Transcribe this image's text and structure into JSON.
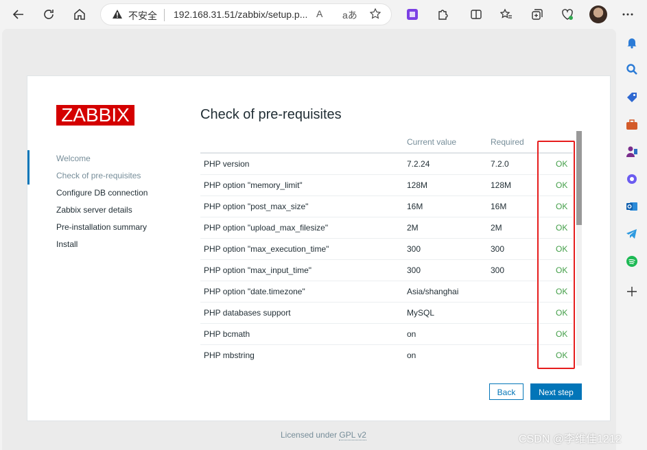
{
  "browser": {
    "insecure_label": "不安全",
    "url": "192.168.31.51/zabbix/setup.p...",
    "read_aloud_glyph": "A",
    "translate_glyph": "aあ"
  },
  "logo": "ZABBIX",
  "steps": [
    {
      "label": "Welcome"
    },
    {
      "label": "Check of pre-requisites"
    },
    {
      "label": "Configure DB connection"
    },
    {
      "label": "Zabbix server details"
    },
    {
      "label": "Pre-installation summary"
    },
    {
      "label": "Install"
    }
  ],
  "title": "Check of pre-requisites",
  "table": {
    "headers": [
      "",
      "Current value",
      "Required",
      ""
    ],
    "rows": [
      {
        "name": "PHP version",
        "current": "7.2.24",
        "required": "7.2.0",
        "status": "OK"
      },
      {
        "name": "PHP option \"memory_limit\"",
        "current": "128M",
        "required": "128M",
        "status": "OK"
      },
      {
        "name": "PHP option \"post_max_size\"",
        "current": "16M",
        "required": "16M",
        "status": "OK"
      },
      {
        "name": "PHP option \"upload_max_filesize\"",
        "current": "2M",
        "required": "2M",
        "status": "OK"
      },
      {
        "name": "PHP option \"max_execution_time\"",
        "current": "300",
        "required": "300",
        "status": "OK"
      },
      {
        "name": "PHP option \"max_input_time\"",
        "current": "300",
        "required": "300",
        "status": "OK"
      },
      {
        "name": "PHP option \"date.timezone\"",
        "current": "Asia/shanghai",
        "required": "",
        "status": "OK"
      },
      {
        "name": "PHP databases support",
        "current": "MySQL",
        "required": "",
        "status": "OK"
      },
      {
        "name": "PHP bcmath",
        "current": "on",
        "required": "",
        "status": "OK"
      },
      {
        "name": "PHP mbstring",
        "current": "on",
        "required": "",
        "status": "OK"
      }
    ]
  },
  "buttons": {
    "back": "Back",
    "next": "Next step"
  },
  "footer": {
    "prefix": "Licensed under ",
    "link": "GPL v2"
  },
  "watermark": "CSDN @李维佳1212",
  "colors": {
    "brand_red": "#d40000",
    "accent_blue": "#0275b8",
    "ok_green": "#429e47",
    "highlight_red": "#e61c1c"
  }
}
